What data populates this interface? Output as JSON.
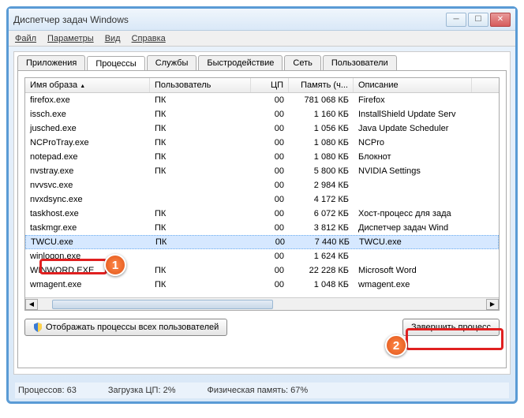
{
  "window": {
    "title": "Диспетчер задач Windows"
  },
  "menu": {
    "file": "Файл",
    "options": "Параметры",
    "view": "Вид",
    "help": "Справка"
  },
  "tabs": {
    "applications": "Приложения",
    "processes": "Процессы",
    "services": "Службы",
    "performance": "Быстродействие",
    "networking": "Сеть",
    "users": "Пользователи"
  },
  "columns": {
    "image": "Имя образа",
    "user": "Пользователь",
    "cpu": "ЦП",
    "memory": "Память (ч...",
    "description": "Описание"
  },
  "rows": [
    {
      "image": "firefox.exe",
      "user": "ПК",
      "cpu": "00",
      "memory": "781 068 КБ",
      "description": "Firefox"
    },
    {
      "image": "issch.exe",
      "user": "ПК",
      "cpu": "00",
      "memory": "1 160 КБ",
      "description": "InstallShield Update Serv"
    },
    {
      "image": "jusched.exe",
      "user": "ПК",
      "cpu": "00",
      "memory": "1 056 КБ",
      "description": "Java Update Scheduler"
    },
    {
      "image": "NCProTray.exe",
      "user": "ПК",
      "cpu": "00",
      "memory": "1 080 КБ",
      "description": "NCPro"
    },
    {
      "image": "notepad.exe",
      "user": "ПК",
      "cpu": "00",
      "memory": "1 080 КБ",
      "description": "Блокнот"
    },
    {
      "image": "nvstray.exe",
      "user": "ПК",
      "cpu": "00",
      "memory": "5 800 КБ",
      "description": "NVIDIA Settings"
    },
    {
      "image": "nvvsvc.exe",
      "user": "",
      "cpu": "00",
      "memory": "2 984 КБ",
      "description": ""
    },
    {
      "image": "nvxdsync.exe",
      "user": "",
      "cpu": "00",
      "memory": "4 172 КБ",
      "description": ""
    },
    {
      "image": "taskhost.exe",
      "user": "ПК",
      "cpu": "00",
      "memory": "6 072 КБ",
      "description": "Хост-процесс для зада"
    },
    {
      "image": "taskmgr.exe",
      "user": "ПК",
      "cpu": "00",
      "memory": "3 812 КБ",
      "description": "Диспетчер задач Wind"
    },
    {
      "image": "TWCU.exe",
      "user": "ПК",
      "cpu": "00",
      "memory": "7 440 КБ",
      "description": "TWCU.exe",
      "selected": true
    },
    {
      "image": "winlogon.exe",
      "user": "",
      "cpu": "00",
      "memory": "1 624 КБ",
      "description": ""
    },
    {
      "image": "WINWORD.EXE",
      "user": "ПК",
      "cpu": "00",
      "memory": "22 228 КБ",
      "description": "Microsoft Word"
    },
    {
      "image": "wmagent.exe",
      "user": "ПК",
      "cpu": "00",
      "memory": "1 048 КБ",
      "description": "wmagent.exe"
    }
  ],
  "buttons": {
    "show_all": "Отображать процессы всех пользователей",
    "end_process": "Завершить процесс"
  },
  "status": {
    "processes": "Процессов: 63",
    "cpu": "Загрузка ЦП: 2%",
    "memory": "Физическая память: 67%"
  },
  "annotations": {
    "a1": "1",
    "a2": "2"
  }
}
